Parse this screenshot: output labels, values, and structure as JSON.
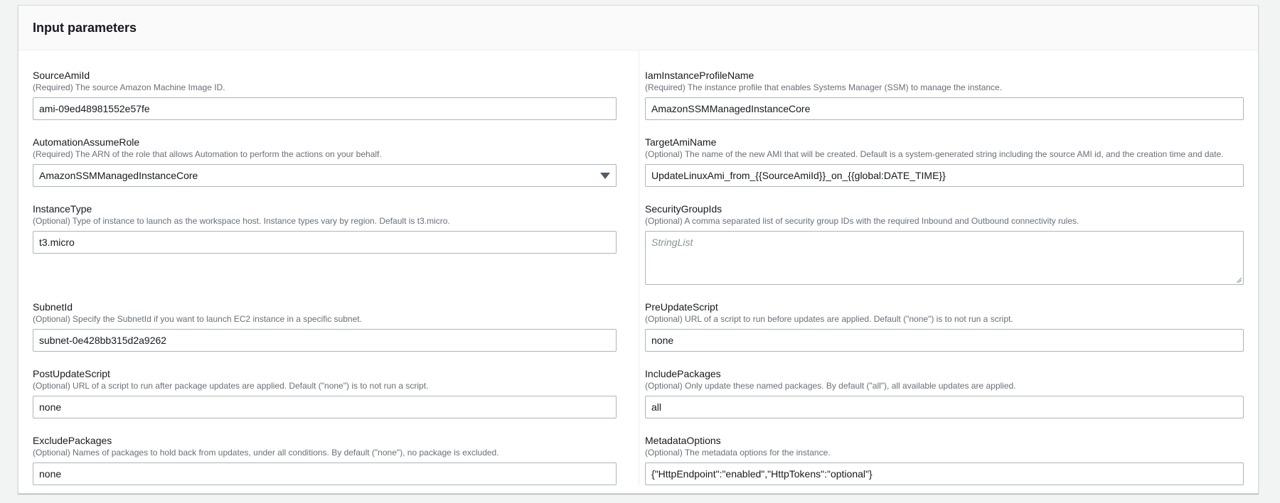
{
  "panel": {
    "title": "Input parameters"
  },
  "left": [
    {
      "label": "SourceAmiId",
      "desc": "(Required) The source Amazon Machine Image ID.",
      "value": "ami-09ed48981552e57fe",
      "kind": "text"
    },
    {
      "label": "AutomationAssumeRole",
      "desc": "(Required) The ARN of the role that allows Automation to perform the actions on your behalf.",
      "value": "AmazonSSMManagedInstanceCore",
      "kind": "select"
    },
    {
      "label": "InstanceType",
      "desc": "(Optional) Type of instance to launch as the workspace host. Instance types vary by region. Default is t3.micro.",
      "value": "t3.micro",
      "kind": "text"
    },
    {
      "label": "SubnetId",
      "desc": "(Optional) Specify the SubnetId if you want to launch EC2 instance in a specific subnet.",
      "value": "subnet-0e428bb315d2a9262",
      "kind": "text"
    },
    {
      "label": "PostUpdateScript",
      "desc": "(Optional) URL of a script to run after package updates are applied. Default (\"none\") is to not run a script.",
      "value": "none",
      "kind": "text"
    },
    {
      "label": "ExcludePackages",
      "desc": "(Optional) Names of packages to hold back from updates, under all conditions. By default (\"none\"), no package is excluded.",
      "value": "none",
      "kind": "text"
    }
  ],
  "right": [
    {
      "label": "IamInstanceProfileName",
      "desc": "(Required) The instance profile that enables Systems Manager (SSM) to manage the instance.",
      "value": "AmazonSSMManagedInstanceCore",
      "kind": "text"
    },
    {
      "label": "TargetAmiName",
      "desc": "(Optional) The name of the new AMI that will be created. Default is a system-generated string including the source AMI id, and the creation time and date.",
      "value": "UpdateLinuxAmi_from_{{SourceAmiId}}_on_{{global:DATE_TIME}}",
      "kind": "text"
    },
    {
      "label": "SecurityGroupIds",
      "desc": "(Optional) A comma separated list of security group IDs with the required Inbound and Outbound connectivity rules.",
      "placeholder": "StringList",
      "kind": "textarea"
    },
    {
      "label": "PreUpdateScript",
      "desc": "(Optional) URL of a script to run before updates are applied. Default (\"none\") is to not run a script.",
      "value": "none",
      "kind": "text"
    },
    {
      "label": "IncludePackages",
      "desc": "(Optional) Only update these named packages. By default (\"all\"), all available updates are applied.",
      "value": "all",
      "kind": "text"
    },
    {
      "label": "MetadataOptions",
      "desc": "(Optional) The metadata options for the instance.",
      "value": "{\"HttpEndpoint\":\"enabled\",\"HttpTokens\":\"optional\"}",
      "kind": "text"
    }
  ],
  "icons": {
    "select_caret": "caret-down-icon",
    "resize": "resize-handle-icon"
  }
}
